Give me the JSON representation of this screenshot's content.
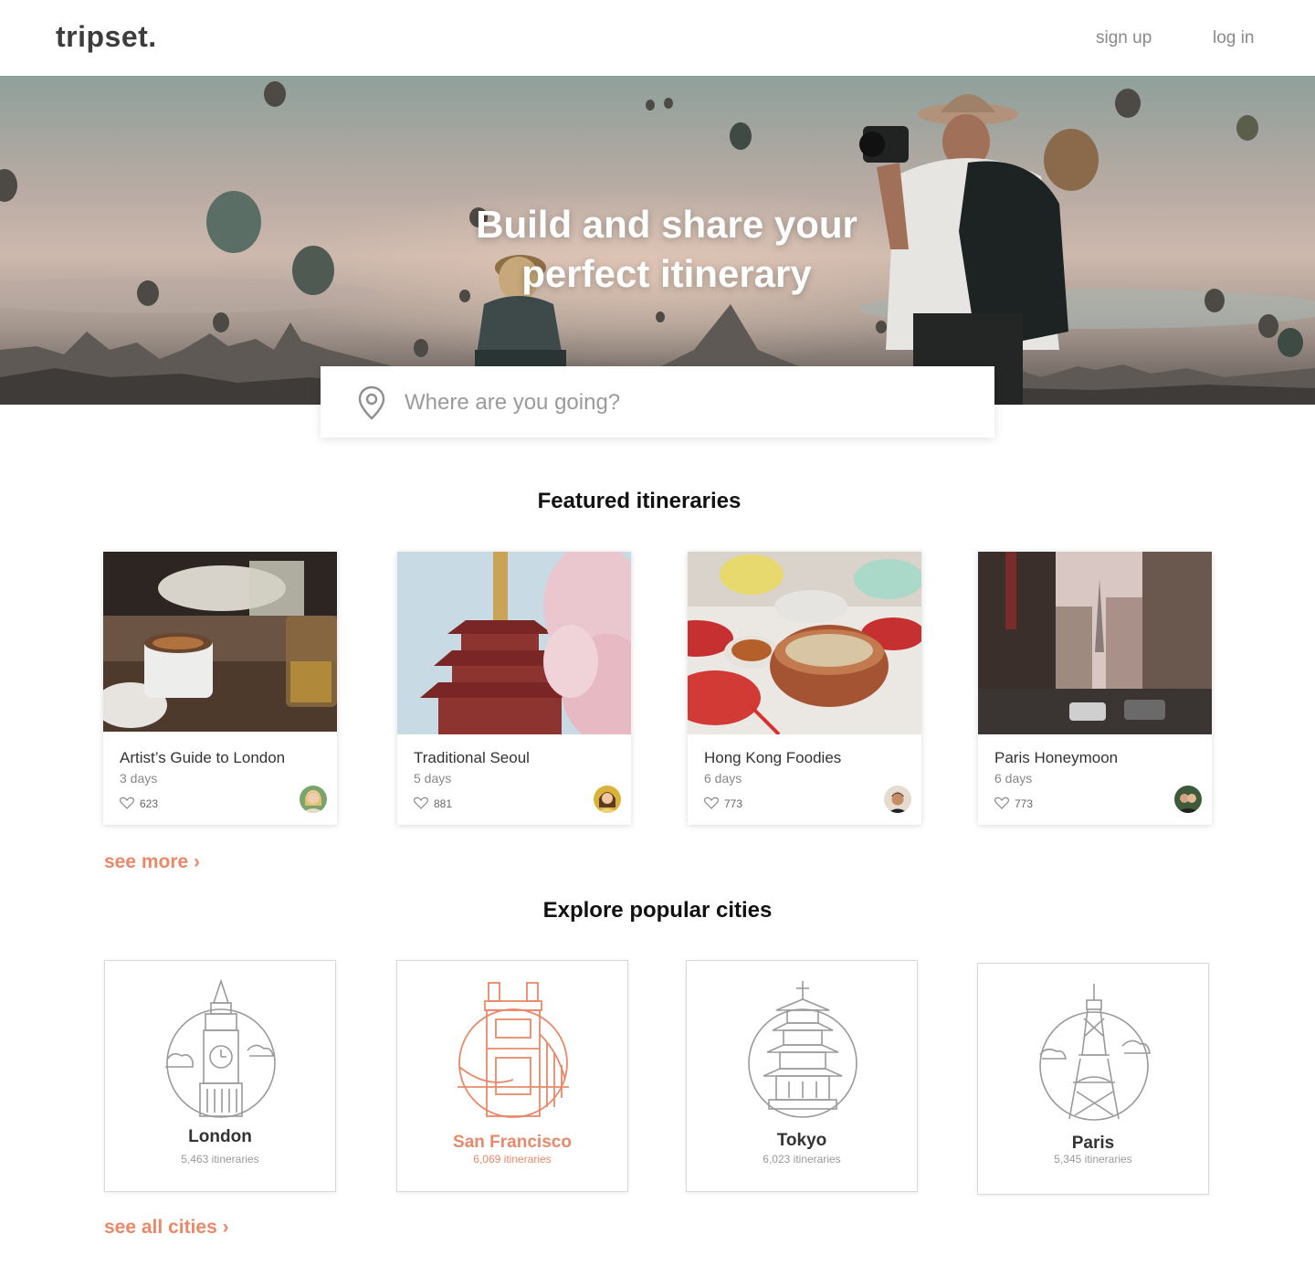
{
  "header": {
    "logo": "tripset.",
    "signup": "sign up",
    "login": "log in"
  },
  "hero": {
    "title_line1": "Build and share your",
    "title_line2": "perfect itinerary"
  },
  "search": {
    "placeholder": "Where are you going?"
  },
  "featured": {
    "title": "Featured itineraries",
    "see_more": "see more ›",
    "cards": [
      {
        "name": "Artist’s Guide to London",
        "days": "3 days",
        "likes": "623"
      },
      {
        "name": "Traditional Seoul",
        "days": "5 days",
        "likes": "881"
      },
      {
        "name": "Hong Kong Foodies",
        "days": "6 days",
        "likes": "773"
      },
      {
        "name": "Paris Honeymoon",
        "days": "6 days",
        "likes": "773"
      }
    ]
  },
  "cities": {
    "title": "Explore popular cities",
    "see_all": "see all cities ›",
    "items": [
      {
        "name": "London",
        "count": "5,463 itineraries",
        "icon": "big-ben-icon"
      },
      {
        "name": "San Francisco",
        "count": "6,069 itineraries",
        "icon": "golden-gate-bridge-icon"
      },
      {
        "name": "Tokyo",
        "count": "6,023 itineraries",
        "icon": "pagoda-icon"
      },
      {
        "name": "Paris",
        "count": "5,345 itineraries",
        "icon": "eiffel-tower-icon"
      }
    ]
  },
  "colors": {
    "accent": "#e8896a",
    "text": "#333333",
    "muted": "#8a8a8a"
  }
}
